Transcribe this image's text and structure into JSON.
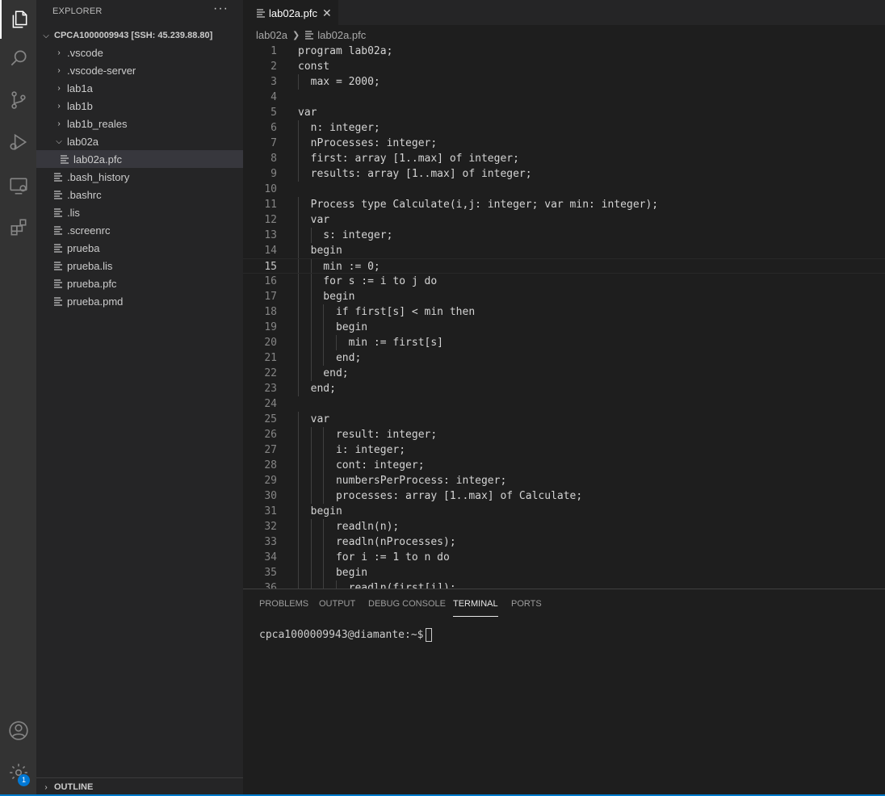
{
  "sidebar": {
    "title": "EXPLORER",
    "more_actions": "···",
    "root_label": "CPCA1000009943 [SSH: 45.239.88.80]",
    "items": [
      {
        "label": ".vscode",
        "type": "folder",
        "state": "collapsed"
      },
      {
        "label": ".vscode-server",
        "type": "folder",
        "state": "collapsed"
      },
      {
        "label": "lab1a",
        "type": "folder",
        "state": "collapsed"
      },
      {
        "label": "lab1b",
        "type": "folder",
        "state": "collapsed"
      },
      {
        "label": "lab1b_reales",
        "type": "folder",
        "state": "collapsed"
      },
      {
        "label": "lab02a",
        "type": "folder",
        "state": "expanded"
      },
      {
        "label": "lab02a.pfc",
        "type": "file",
        "selected": true
      },
      {
        "label": ".bash_history",
        "type": "file"
      },
      {
        "label": ".bashrc",
        "type": "file"
      },
      {
        "label": ".lis",
        "type": "file"
      },
      {
        "label": ".screenrc",
        "type": "file"
      },
      {
        "label": "prueba",
        "type": "file"
      },
      {
        "label": "prueba.lis",
        "type": "file"
      },
      {
        "label": "prueba.pfc",
        "type": "file"
      },
      {
        "label": "prueba.pmd",
        "type": "file"
      }
    ],
    "outline_label": "OUTLINE"
  },
  "activity_bar": {
    "icons": [
      "files-icon",
      "search-icon",
      "source-control-icon",
      "run-debug-icon",
      "remote-explorer-icon",
      "extensions-icon"
    ],
    "bottom_icons": [
      "account-icon",
      "manage-gear-icon"
    ],
    "badge": "1"
  },
  "editor": {
    "tab_label": "lab02a.pfc",
    "tab_close": "✕",
    "breadcrumb": [
      "lab02a",
      "lab02a.pfc"
    ],
    "current_line": 15,
    "lines": [
      "program lab02a;",
      "const",
      "  max = 2000;",
      "",
      "var",
      "  n: integer;",
      "  nProcesses: integer;",
      "  first: array [1..max] of integer;",
      "  results: array [1..max] of integer;",
      "",
      "  Process type Calculate(i,j: integer; var min: integer);",
      "  var",
      "    s: integer;",
      "  begin",
      "    min := 0;",
      "    for s := i to j do",
      "    begin",
      "      if first[s] < min then",
      "      begin",
      "        min := first[s]",
      "      end;",
      "    end;",
      "  end;",
      "",
      "  var",
      "      result: integer;",
      "      i: integer;",
      "      cont: integer;",
      "      numbersPerProcess: integer;",
      "      processes: array [1..max] of Calculate;",
      "  begin",
      "      readln(n);",
      "      readln(nProcesses);",
      "      for i := 1 to n do",
      "      begin",
      "        readln(first[i]);"
    ]
  },
  "panel": {
    "tabs": [
      "PROBLEMS",
      "OUTPUT",
      "DEBUG CONSOLE",
      "TERMINAL",
      "PORTS"
    ],
    "active_tab": "TERMINAL",
    "terminal_prompt": "cpca1000009943@diamante:~$"
  },
  "colors": {
    "activity_bar": "#333333",
    "sidebar": "#252526",
    "editor_bg": "#1e1e1e",
    "accent": "#007acc",
    "badge": "#0078d4"
  }
}
